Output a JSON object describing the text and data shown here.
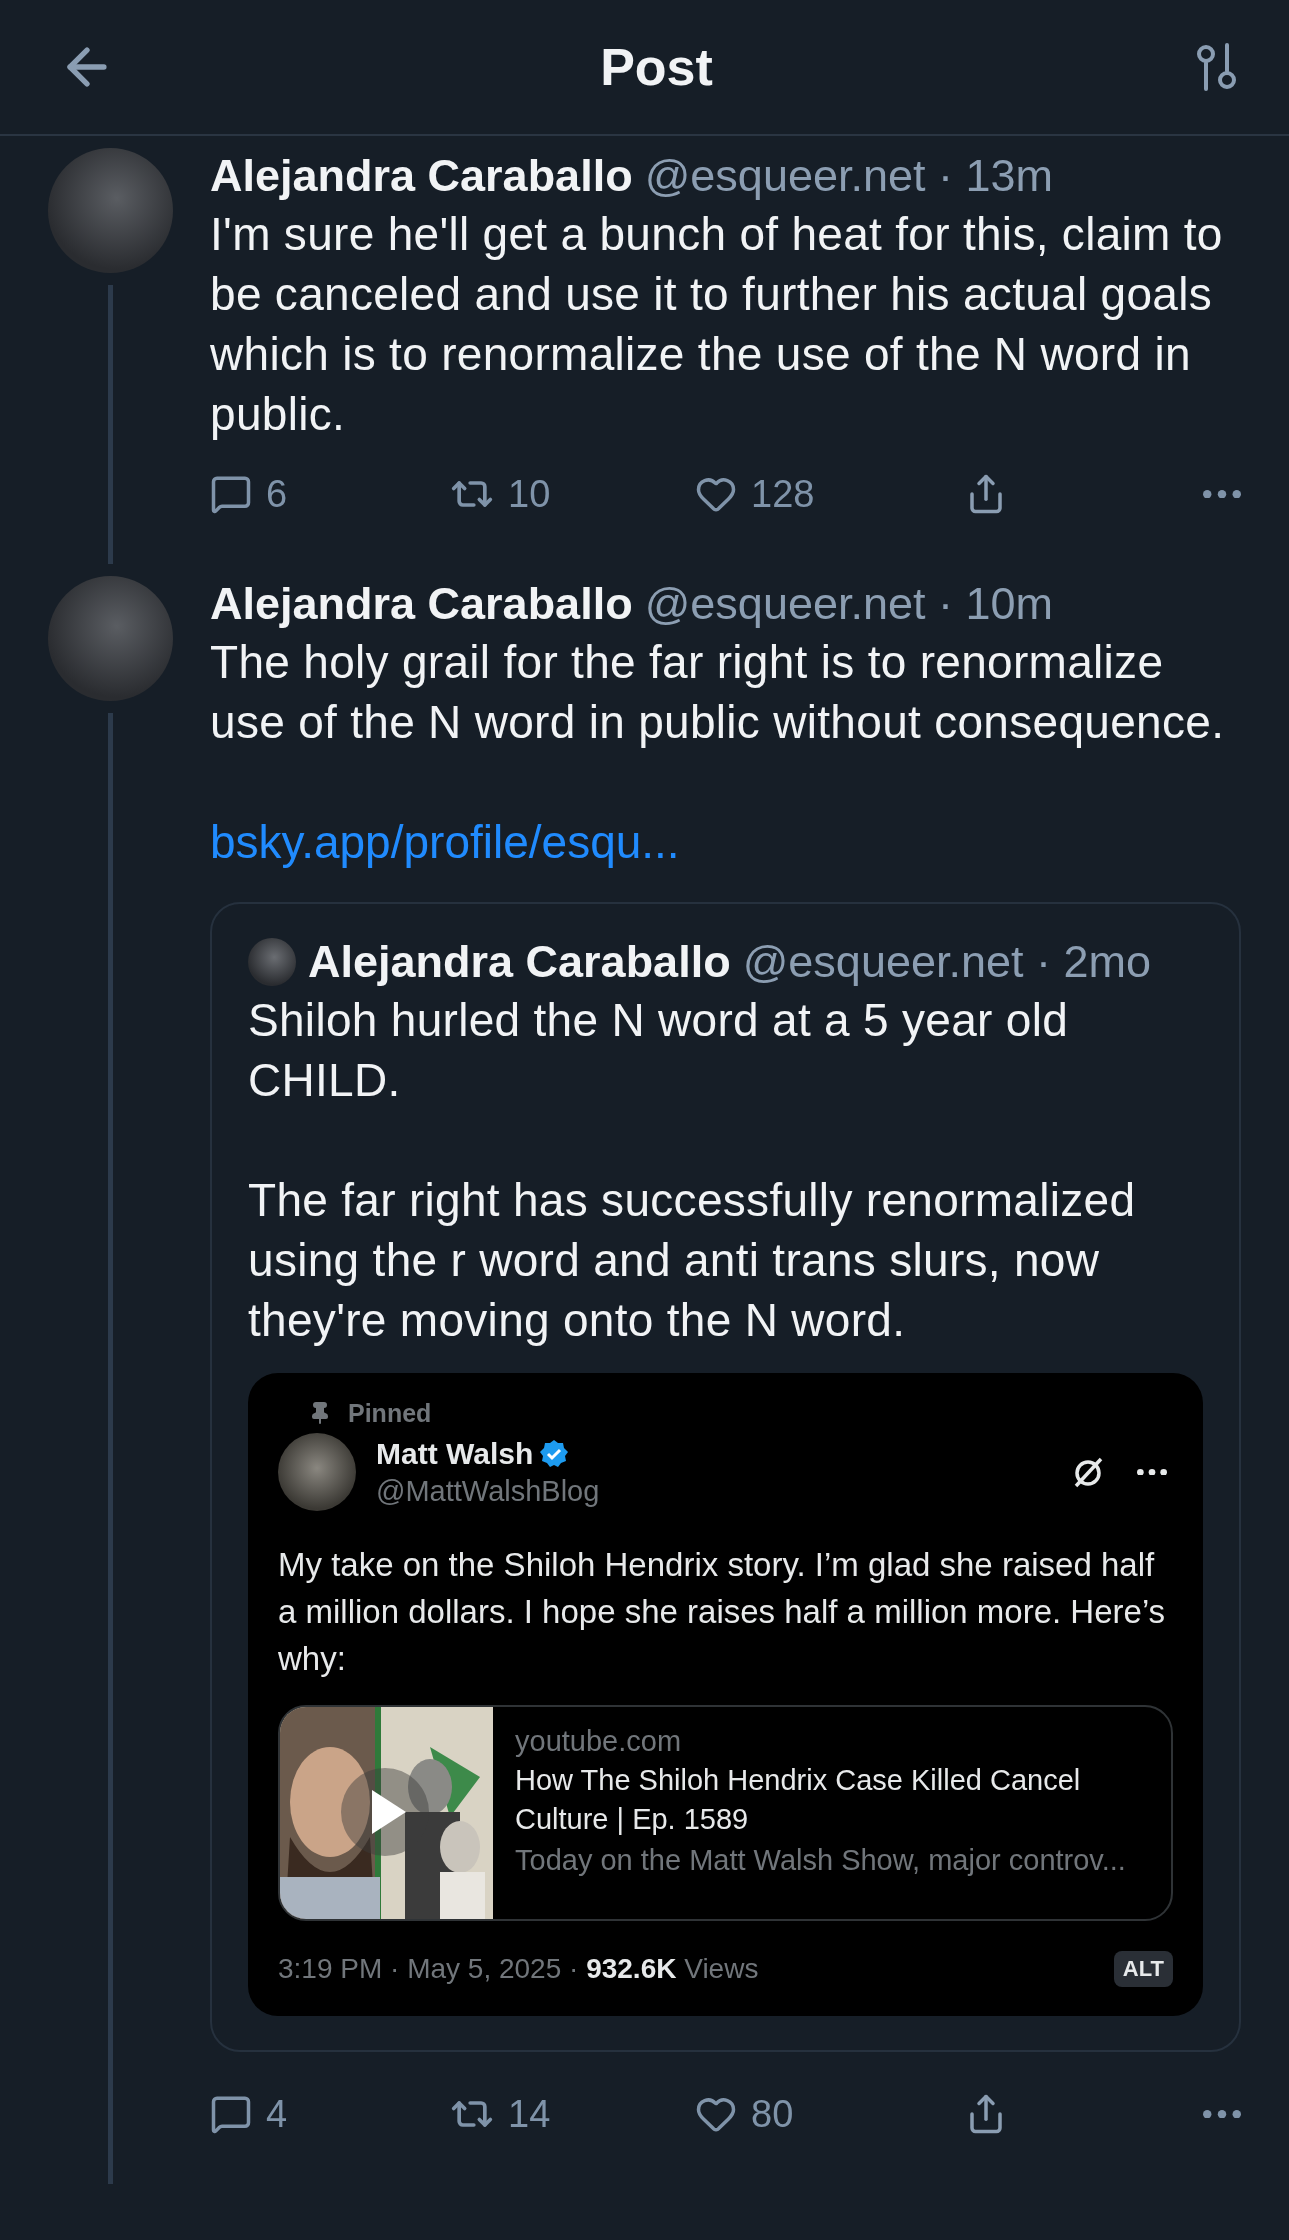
{
  "header": {
    "title": "Post"
  },
  "posts": [
    {
      "author": "Alejandra Caraballo",
      "handle_time": "@esqueer.net · 13m",
      "paragraphs": [
        "I'm sure he'll get a bunch of heat for this, claim to be canceled and use it to further his actual goals which is to renormalize the use of the N word in public."
      ],
      "stats": {
        "replies": "6",
        "reposts": "10",
        "likes": "128"
      }
    },
    {
      "author": "Alejandra Caraballo",
      "handle_time": "@esqueer.net · 10m",
      "paragraphs": [
        "The holy grail for the far right is to renormalize use of the N word in public without consequence."
      ],
      "link": "bsky.app/profile/esqu...",
      "quote": {
        "author": "Alejandra Caraballo",
        "handle_time": "@esqueer.net · 2mo",
        "paragraphs": [
          "Shiloh hurled the N word at a 5 year old CHILD.",
          "The far right has successfully renormalized using the r word and anti trans slurs, now they're moving onto the N word."
        ],
        "image": {
          "pinned_label": "Pinned",
          "name": "Matt Walsh",
          "verified": true,
          "handle": "@MattWalshBlog",
          "text": "My take on the Shiloh Hendrix story. I’m glad she raised half a million dollars. I hope she raises half a million more. Here’s why:",
          "link_card": {
            "domain": "youtube.com",
            "title": "How The Shiloh Hendrix Case Killed Cancel Culture | Ep. 1589",
            "description": "Today on the Matt Walsh Show, major controv..."
          },
          "footer": "3:19 PM · May 5, 2025 · **932.6K** Views",
          "alt": "ALT"
        }
      },
      "stats": {
        "replies": "4",
        "reposts": "14",
        "likes": "80"
      }
    }
  ]
}
